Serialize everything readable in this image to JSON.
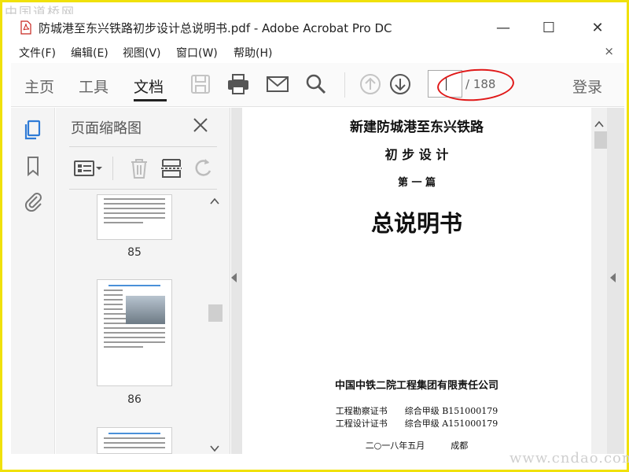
{
  "watermark_top": "中国道桥网",
  "watermark_bottom": "www.cndao.com",
  "window": {
    "title": "防城港至东兴铁路初步设计总说明书.pdf - Adobe Acrobat Pro DC",
    "minimize": "—",
    "maximize": "☐",
    "close": "✕"
  },
  "menu": {
    "items": [
      "文件(F)",
      "编辑(E)",
      "视图(V)",
      "窗口(W)",
      "帮助(H)"
    ],
    "close": "×"
  },
  "toolbar": {
    "tabs": [
      "主页",
      "工具",
      "文档"
    ],
    "active_tab": "文档",
    "page_current": "",
    "page_total": "/ 188",
    "login": "登录",
    "icons": [
      "save-icon",
      "print-icon",
      "email-icon",
      "search-icon",
      "prev-page-icon",
      "next-page-icon"
    ]
  },
  "rail": {
    "icons": [
      "pages-icon",
      "bookmark-icon",
      "attachment-icon"
    ]
  },
  "thumbnails": {
    "title": "页面缩略图",
    "pages": [
      {
        "num": "85"
      },
      {
        "num": "86"
      }
    ],
    "tools": [
      "thumbnail-options-icon",
      "delete-icon",
      "extract-icon",
      "rotate-icon"
    ]
  },
  "document": {
    "heading": "新建防城港至东兴铁路",
    "subheading": "初 步 设 计",
    "part": "第 一 篇",
    "title": "总说明书",
    "company": "中国中铁二院工程集团有限责任公司",
    "cert1": "工程勘察证书　　综合甲级 B151000179",
    "cert2": "工程设计证书　　综合甲级 A151000179",
    "date_place": "二○一八年五月　　　成都"
  },
  "colors": {
    "highlight_circle": "#e01818",
    "frame": "#f0e10a",
    "accent_blue": "#2f7bd6"
  }
}
